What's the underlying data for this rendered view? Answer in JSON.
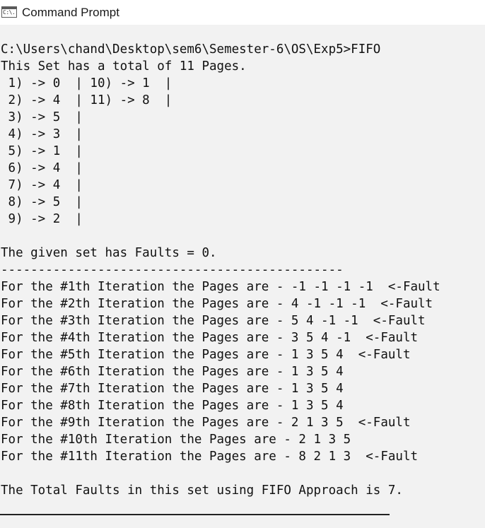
{
  "window": {
    "title": "Command Prompt",
    "icon": "console-window-icon",
    "icon_text": "C:\\."
  },
  "console": {
    "lines": [
      "C:\\Users\\chand\\Desktop\\sem6\\Semester-6\\OS\\Exp5>FIFO",
      "This Set has a total of 11 Pages.",
      " 1) -> 0  | 10) -> 1  |",
      " 2) -> 4  | 11) -> 8  |",
      " 3) -> 5  |",
      " 4) -> 3  |",
      " 5) -> 1  |",
      " 6) -> 4  |",
      " 7) -> 4  |",
      " 8) -> 5  |",
      " 9) -> 2  |",
      "",
      "The given set has Faults = 0.",
      "----------------------------------------------",
      "For the #1th Iteration the Pages are - -1 -1 -1 -1  <-Fault",
      "For the #2th Iteration the Pages are - 4 -1 -1 -1  <-Fault",
      "For the #3th Iteration the Pages are - 5 4 -1 -1  <-Fault",
      "For the #4th Iteration the Pages are - 3 5 4 -1  <-Fault",
      "For the #5th Iteration the Pages are - 1 3 5 4  <-Fault",
      "For the #6th Iteration the Pages are - 1 3 5 4",
      "For the #7th Iteration the Pages are - 1 3 5 4",
      "For the #8th Iteration the Pages are - 1 3 5 4",
      "For the #9th Iteration the Pages are - 2 1 3 5  <-Fault",
      "For the #10th Iteration the Pages are - 2 1 3 5",
      "For the #11th Iteration the Pages are - 8 2 1 3  <-Fault",
      "",
      "The Total Faults in this set using FIFO Approach is 7."
    ]
  }
}
